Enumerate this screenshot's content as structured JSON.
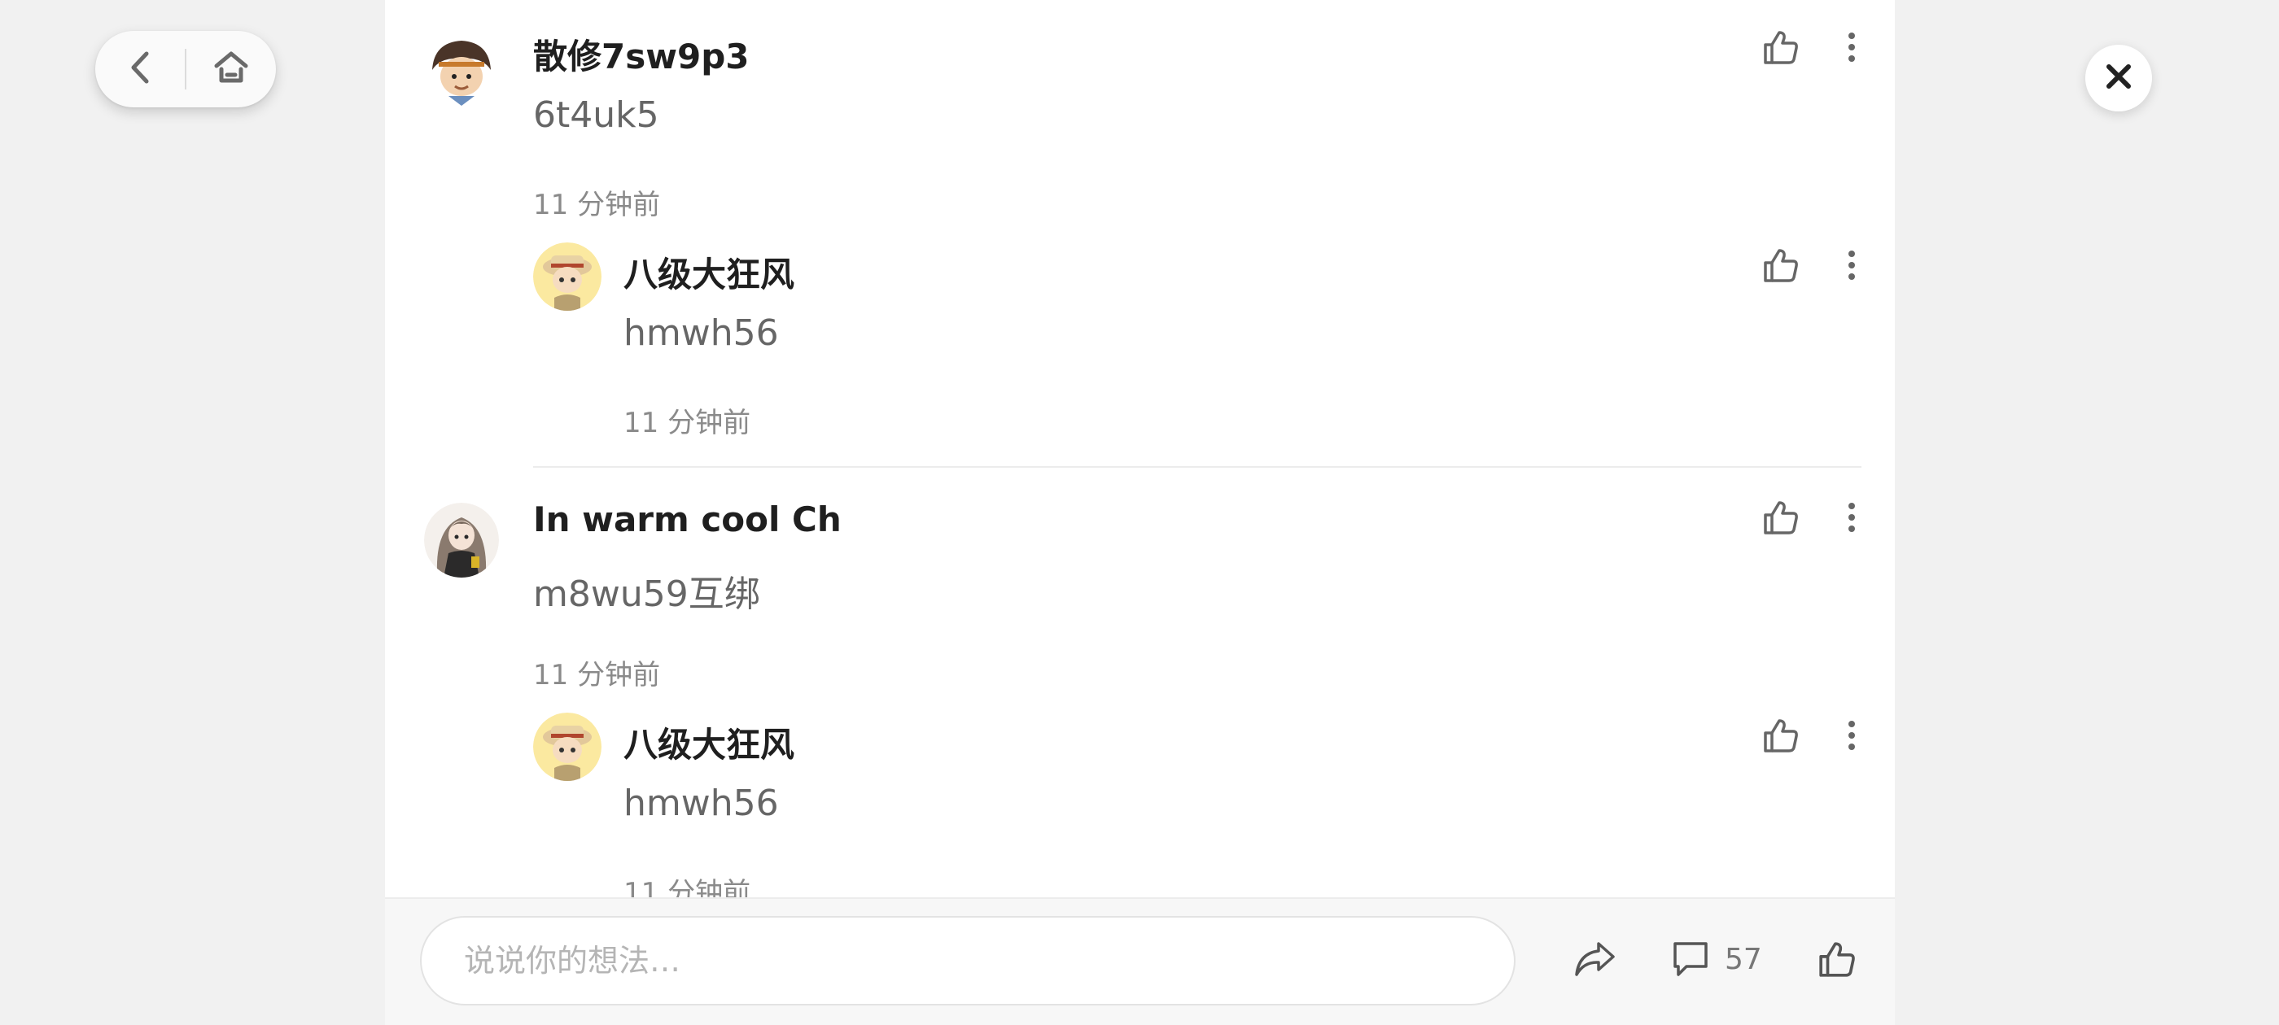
{
  "nav": {
    "back_icon": "chevron-left-icon",
    "home_icon": "home-icon"
  },
  "close_icon": "close-icon",
  "comments": [
    {
      "user": "散修7sw9p3",
      "text": "6t4uk5",
      "time": "11 分钟前",
      "reply": {
        "user": "八级大狂风",
        "text": "hmwh56",
        "time": "11 分钟前"
      }
    },
    {
      "user": "In warm cool Ch",
      "text": "m8wu59互绑",
      "time": "11 分钟前",
      "reply": {
        "user": "八级大狂风",
        "text": "hmwh56",
        "time": "11 分钟前"
      }
    }
  ],
  "bottom_bar": {
    "input_placeholder": "说说你的想法…",
    "share_icon": "share-icon",
    "comment_icon": "comment-icon",
    "comment_count": "57",
    "like_icon": "thumbs-up-icon"
  }
}
